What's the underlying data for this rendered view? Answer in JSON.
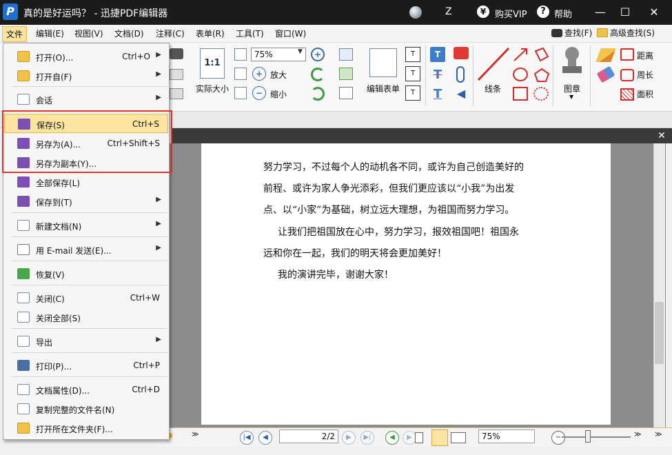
{
  "app": {
    "title": "真的是好运吗？ - 迅捷PDF编辑器",
    "logo_letter": "P",
    "user_initial": "Z",
    "vip_symbol": "¥",
    "vip_label": "购买VIP",
    "help_symbol": "?",
    "help_label": "帮助",
    "min_symbol": "—",
    "max_symbol": "☐",
    "close_symbol": "✕"
  },
  "menubar": {
    "items": [
      "文件",
      "编辑(E)",
      "视图(V)",
      "文档(D)",
      "注释(C)",
      "表单(R)",
      "工具(T)",
      "窗口(W)"
    ],
    "search_label": "查找(F)",
    "adv_search_label": "高级查找(S)"
  },
  "toolbar": {
    "actual_size_icon_text": "1:1",
    "actual_size_label": "实际大小",
    "zoom_value": "75%",
    "zoom_in_label": "放大",
    "zoom_out_label": "缩小",
    "edit_form_label": "编辑表单",
    "lines_label": "线条",
    "stamp_label": "图章",
    "distance_label": "距离",
    "perimeter_label": "周长",
    "area_label": "面积"
  },
  "file_menu": {
    "items": [
      {
        "label": "打开(O)...",
        "shortcut": "Ctrl+O",
        "submenu": true
      },
      {
        "label": "打开自(F)",
        "shortcut": "",
        "submenu": true
      },
      {
        "label": "会话",
        "shortcut": "",
        "submenu": true
      },
      {
        "label": "保存(S)",
        "shortcut": "Ctrl+S",
        "submenu": false
      },
      {
        "label": "另存为(A)...",
        "shortcut": "Ctrl+Shift+S",
        "submenu": false
      },
      {
        "label": "另存为副本(Y)...",
        "shortcut": "",
        "submenu": false
      },
      {
        "label": "全部保存(L)",
        "shortcut": "",
        "submenu": false
      },
      {
        "label": "保存到(T)",
        "shortcut": "",
        "submenu": true
      },
      {
        "label": "新建文档(N)",
        "shortcut": "",
        "submenu": true
      },
      {
        "label": "用 E-mail 发送(E)...",
        "shortcut": "",
        "submenu": true
      },
      {
        "label": "恢复(V)",
        "shortcut": "",
        "submenu": false
      },
      {
        "label": "关闭(C)",
        "shortcut": "Ctrl+W",
        "submenu": false
      },
      {
        "label": "关闭全部(S)",
        "shortcut": "",
        "submenu": false
      },
      {
        "label": "导出",
        "shortcut": "",
        "submenu": true
      },
      {
        "label": "打印(P)...",
        "shortcut": "Ctrl+P",
        "submenu": false
      },
      {
        "label": "文档属性(D)...",
        "shortcut": "Ctrl+D",
        "submenu": false
      },
      {
        "label": "复制完整的文件名(N)",
        "shortcut": "",
        "submenu": false
      },
      {
        "label": "打开所在文件夹(F)...",
        "shortcut": "",
        "submenu": false
      }
    ]
  },
  "document": {
    "lines": [
      "努力学习，不过每个人的动机各不同，或许为自己创造美好的",
      "前程、或许为家人争光添彩，但我们更应该以“小我”为出发",
      "点、以“小家”为基础，树立远大理想，为祖国而努力学习。",
      "让我们把祖国放在心中，努力学习，报效祖国吧！祖国永",
      "远和你在一起，我们的明天将会更加美好！",
      "我的演讲完毕，谢谢大家！"
    ]
  },
  "statusbar": {
    "page_value": "2/2",
    "zoom_value": "75%"
  },
  "colors": {
    "highlight": "#fbe3a0",
    "red_box": "#e0302b",
    "title_bg": "#1b1b1b"
  }
}
